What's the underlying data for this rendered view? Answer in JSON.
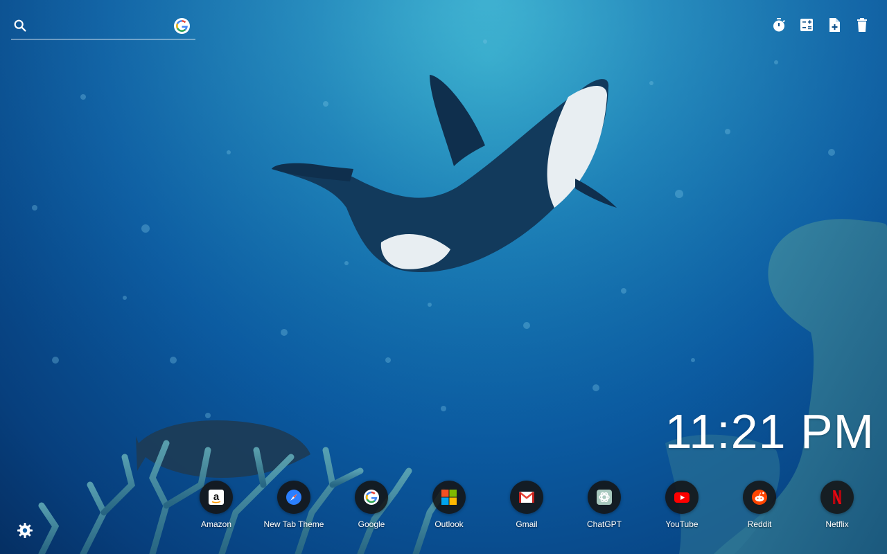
{
  "search": {
    "placeholder": "",
    "engine_icon": "google-g-icon"
  },
  "toolbar": {
    "icons": [
      "timer-icon",
      "calculator-icon",
      "note-add-icon",
      "trash-icon"
    ]
  },
  "clock": {
    "time": "11:21 PM"
  },
  "shortcuts": [
    {
      "label": "Amazon",
      "icon": "amazon-icon"
    },
    {
      "label": "New Tab Theme",
      "icon": "compass-icon"
    },
    {
      "label": "Google",
      "icon": "google-icon"
    },
    {
      "label": "Outlook",
      "icon": "microsoft-icon"
    },
    {
      "label": "Gmail",
      "icon": "gmail-icon"
    },
    {
      "label": "ChatGPT",
      "icon": "chatgpt-icon"
    },
    {
      "label": "YouTube",
      "icon": "youtube-icon"
    },
    {
      "label": "Reddit",
      "icon": "reddit-icon"
    },
    {
      "label": "Netflix",
      "icon": "netflix-icon"
    }
  ],
  "settings": {
    "icon": "gear-icon"
  },
  "colors": {
    "ocean_light": "#2aa0c4",
    "ocean_deep": "#052f63",
    "shortcut_bg": "#141414",
    "text": "#ffffff"
  }
}
